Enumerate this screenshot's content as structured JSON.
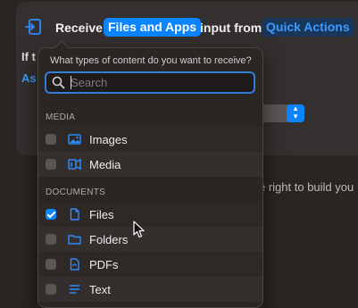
{
  "header": {
    "receive": "Receive",
    "type_pill": "Files and Apps",
    "input_from": "input from",
    "source_pill": "Quick Actions",
    "if_partial": "If t",
    "as_partial": "As"
  },
  "hint_text": "e right to build you",
  "popover": {
    "question": "What types of content do you want to receive?",
    "search_placeholder": "Search",
    "search_value": "",
    "sections": [
      {
        "label": "MEDIA",
        "items": [
          {
            "label": "Images",
            "checked": false,
            "icon": "photo-icon"
          },
          {
            "label": "Media",
            "checked": false,
            "icon": "media-icon"
          }
        ]
      },
      {
        "label": "DOCUMENTS",
        "items": [
          {
            "label": "Files",
            "checked": true,
            "icon": "document-icon"
          },
          {
            "label": "Folders",
            "checked": false,
            "icon": "folder-icon"
          },
          {
            "label": "PDFs",
            "checked": false,
            "icon": "pdf-icon"
          },
          {
            "label": "Text",
            "checked": false,
            "icon": "text-icon"
          }
        ]
      }
    ]
  },
  "colors": {
    "accent": "#0a84ff",
    "background": "#2a2422",
    "popover": "#2b2524"
  }
}
